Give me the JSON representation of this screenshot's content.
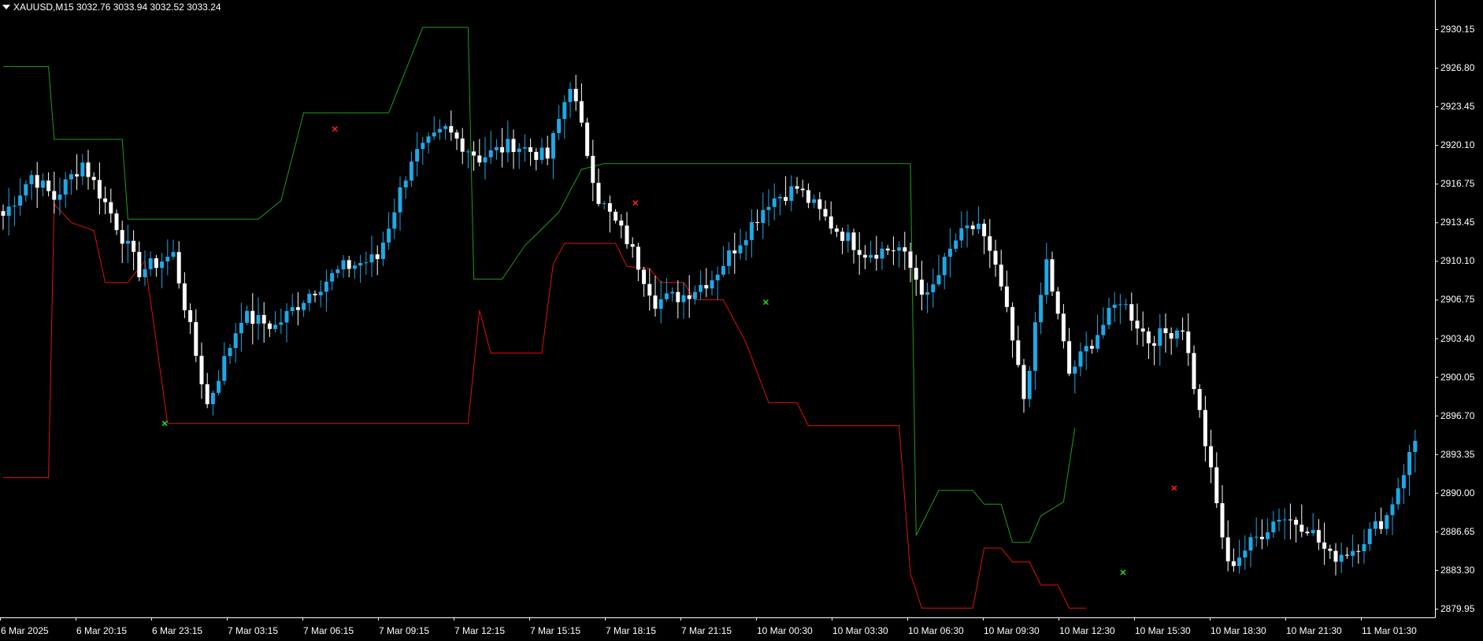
{
  "header": {
    "symbol": "XAUUSD,M15",
    "ohlc": "3032.76 3033.94 3032.52 3033.24"
  },
  "colors": {
    "background": "#000000",
    "bull_candle": "#1ea8e6",
    "bear_candle": "#ffffff",
    "upper_band": "#1e9e1e",
    "lower_band": "#e01010",
    "axis": "#ffffff",
    "signal_buy": "#22dd22",
    "signal_sell": "#ff2020"
  },
  "chart_data": {
    "type": "candlestick",
    "symbol": "XAUUSD",
    "timeframe": "M15",
    "grid": false,
    "ylim": [
      2878.9,
      2931.1
    ],
    "y_ticks": [
      "2930.15",
      "2926.80",
      "2923.45",
      "2920.10",
      "2916.75",
      "2913.45",
      "2910.10",
      "2906.75",
      "2903.40",
      "2900.05",
      "2896.70",
      "2893.35",
      "2890.00",
      "2886.65",
      "2883.30",
      "2879.95"
    ],
    "x_ticks": [
      "6 Mar 2025",
      "6 Mar 20:15",
      "6 Mar 23:15",
      "7 Mar 03:15",
      "7 Mar 06:15",
      "7 Mar 09:15",
      "7 Mar 12:15",
      "7 Mar 15:15",
      "7 Mar 18:15",
      "7 Mar 21:15",
      "10 Mar 00:30",
      "10 Mar 03:30",
      "10 Mar 06:30",
      "10 Mar 09:30",
      "10 Mar 12:30",
      "10 Mar 15:30",
      "10 Mar 18:30",
      "10 Mar 21:30",
      "11 Mar 01:30"
    ],
    "anchors": [
      [
        0,
        2914.0
      ],
      [
        5,
        2917.5
      ],
      [
        9,
        2915.5
      ],
      [
        14,
        2918.6
      ],
      [
        19,
        2914.2
      ],
      [
        24,
        2909.2
      ],
      [
        30,
        2910.6
      ],
      [
        36,
        2897.6
      ],
      [
        42,
        2905.3
      ],
      [
        48,
        2904.4
      ],
      [
        54,
        2907.3
      ],
      [
        60,
        2909.5
      ],
      [
        66,
        2910.3
      ],
      [
        72,
        2919.0
      ],
      [
        78,
        2921.4
      ],
      [
        84,
        2919.0
      ],
      [
        90,
        2920.2
      ],
      [
        96,
        2919.0
      ],
      [
        100,
        2925.5
      ],
      [
        105,
        2915.5
      ],
      [
        110,
        2911.9
      ],
      [
        115,
        2906.6
      ],
      [
        120,
        2907.1
      ],
      [
        125,
        2908.6
      ],
      [
        130,
        2911.9
      ],
      [
        135,
        2915.3
      ],
      [
        140,
        2916.4
      ],
      [
        146,
        2913.2
      ],
      [
        152,
        2910.8
      ],
      [
        158,
        2911.2
      ],
      [
        163,
        2906.8
      ],
      [
        168,
        2911.9
      ],
      [
        172,
        2913.3
      ],
      [
        176,
        2907.8
      ],
      [
        180,
        2898.2
      ],
      [
        184,
        2910.0
      ],
      [
        188,
        2900.3
      ],
      [
        192,
        2903.1
      ],
      [
        197,
        2906.8
      ],
      [
        202,
        2903.2
      ],
      [
        208,
        2904.4
      ],
      [
        212,
        2894.3
      ],
      [
        216,
        2883.6
      ],
      [
        220,
        2885.6
      ],
      [
        225,
        2888.0
      ],
      [
        230,
        2887.1
      ],
      [
        234,
        2884.4
      ],
      [
        238,
        2885.1
      ],
      [
        244,
        2888.0
      ],
      [
        249,
        2894.5
      ]
    ],
    "upper_band": [
      [
        0,
        2926.9
      ],
      [
        8,
        2926.9
      ],
      [
        9,
        2920.6
      ],
      [
        21,
        2920.6
      ],
      [
        22,
        2913.7
      ],
      [
        45,
        2913.7
      ],
      [
        49,
        2915.3
      ],
      [
        53,
        2922.9
      ],
      [
        68,
        2922.9
      ],
      [
        71,
        2926.6
      ],
      [
        74,
        2930.3
      ],
      [
        82,
        2930.3
      ],
      [
        83,
        2908.5
      ],
      [
        88,
        2908.5
      ],
      [
        92,
        2911.4
      ],
      [
        98,
        2914.3
      ],
      [
        102,
        2918.0
      ],
      [
        106,
        2918.5
      ],
      [
        160,
        2918.5
      ],
      [
        161,
        2886.3
      ],
      [
        165,
        2890.2
      ],
      [
        171,
        2890.2
      ],
      [
        173,
        2889.0
      ],
      [
        176,
        2889.0
      ],
      [
        178,
        2885.7
      ],
      [
        181,
        2885.7
      ],
      [
        183,
        2888.0
      ],
      [
        187,
        2889.2
      ],
      [
        189,
        2895.6
      ]
    ],
    "lower_band": [
      [
        0,
        2891.3
      ],
      [
        8,
        2891.3
      ],
      [
        9,
        2915.0
      ],
      [
        12,
        2913.4
      ],
      [
        16,
        2912.7
      ],
      [
        18,
        2908.2
      ],
      [
        22,
        2908.2
      ],
      [
        25,
        2910.1
      ],
      [
        29,
        2896.0
      ],
      [
        82,
        2896.0
      ],
      [
        84,
        2905.8
      ],
      [
        86,
        2902.1
      ],
      [
        95,
        2902.1
      ],
      [
        97,
        2909.8
      ],
      [
        99,
        2911.6
      ],
      [
        108,
        2911.6
      ],
      [
        110,
        2909.6
      ],
      [
        114,
        2909.4
      ],
      [
        116,
        2908.2
      ],
      [
        120,
        2908.2
      ],
      [
        122,
        2906.7
      ],
      [
        127,
        2906.7
      ],
      [
        131,
        2903.0
      ],
      [
        135,
        2897.8
      ],
      [
        140,
        2897.8
      ],
      [
        142,
        2895.8
      ],
      [
        158,
        2895.8
      ],
      [
        160,
        2883.0
      ],
      [
        162,
        2880.0
      ],
      [
        171,
        2880.0
      ],
      [
        173,
        2885.2
      ],
      [
        176,
        2885.2
      ],
      [
        178,
        2884.0
      ],
      [
        181,
        2884.0
      ],
      [
        183,
        2882.0
      ],
      [
        186,
        2882.0
      ],
      [
        188,
        2880.0
      ],
      [
        191,
        2880.0
      ]
    ],
    "signals": [
      {
        "type": "buy",
        "price": 2896.0
      },
      {
        "type": "sell",
        "price": 2921.5
      },
      {
        "type": "buy",
        "price": 2906.5
      },
      {
        "type": "sell",
        "price": 2915.1
      },
      {
        "type": "buy",
        "price": 2883.1
      },
      {
        "type": "sell",
        "price": 2890.4
      }
    ]
  }
}
